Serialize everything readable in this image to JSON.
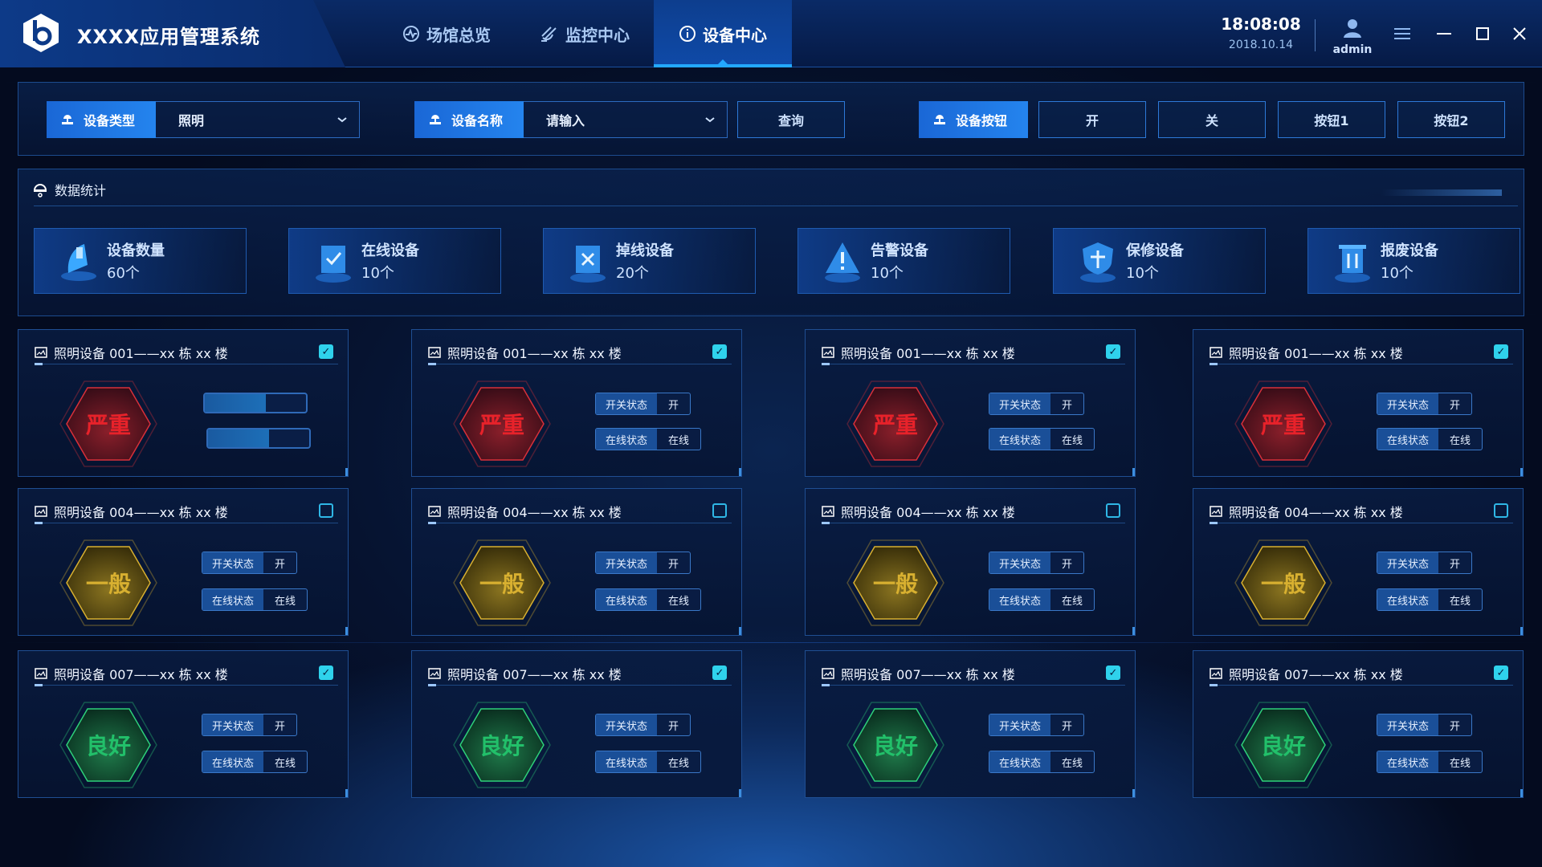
{
  "app": {
    "title": "XXXX应用管理系统"
  },
  "nav": [
    {
      "label": "场馆总览",
      "icon": "pulse-icon"
    },
    {
      "label": "监控中心",
      "icon": "satellite-icon"
    },
    {
      "label": "设备中心",
      "icon": "info-icon",
      "active": true
    }
  ],
  "header": {
    "time": "18:08:08",
    "date": "2018.10.14",
    "user": "admin"
  },
  "filters": {
    "type_label": "设备类型",
    "type_value": "照明",
    "name_label": "设备名称",
    "name_placeholder": "请输入",
    "query": "查询",
    "button_label": "设备按钮",
    "on": "开",
    "off": "关",
    "btn1": "按钮1",
    "btn2": "按钮2"
  },
  "stats": {
    "title": "数据统计",
    "items": [
      {
        "label": "设备数量",
        "value": "60个",
        "icon": "device-count-icon"
      },
      {
        "label": "在线设备",
        "value": "10个",
        "icon": "online-device-icon"
      },
      {
        "label": "掉线设备",
        "value": "20个",
        "icon": "offline-device-icon"
      },
      {
        "label": "告警设备",
        "value": "10个",
        "icon": "alarm-device-icon"
      },
      {
        "label": "保修设备",
        "value": "10个",
        "icon": "warranty-device-icon"
      },
      {
        "label": "报废设备",
        "value": "10个",
        "icon": "scrap-device-icon"
      }
    ]
  },
  "devices": {
    "rows": [
      {
        "name": "照明设备 001——xx 栋 xx 楼",
        "level": "严重",
        "checked": true
      },
      {
        "name": "照明设备 004——xx 栋 xx 楼",
        "level": "一般",
        "checked": false
      },
      {
        "name": "照明设备 007——xx 栋 xx 楼",
        "level": "良好",
        "checked": true
      }
    ],
    "switch_label": "开关状态",
    "switch_value": "开",
    "online_label": "在线状态",
    "online_value": "在线",
    "first_card_bars": [
      0.6,
      0.6
    ],
    "colors": {
      "severe": "#e8222a",
      "normal": "#d8b030",
      "good": "#22c06a"
    }
  }
}
